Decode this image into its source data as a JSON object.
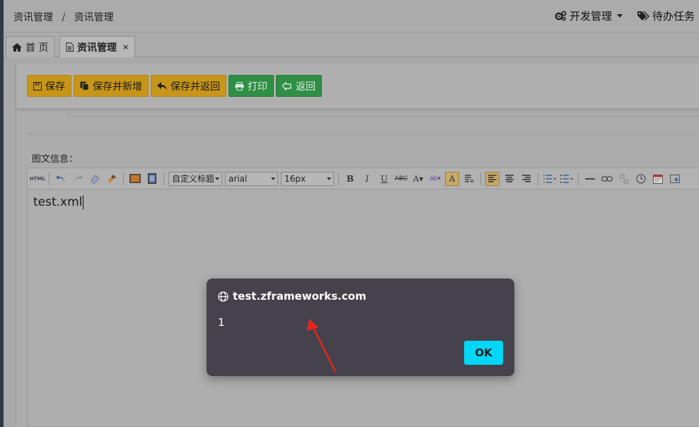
{
  "breadcrumb": {
    "part1": "资讯管理",
    "separator": "/",
    "part2": "资讯管理"
  },
  "top_menu": {
    "dev_manage": "开发管理",
    "todo": "待办任务"
  },
  "tabs": [
    {
      "label": "首 页",
      "icon": "home-icon"
    },
    {
      "label": "资讯管理",
      "icon": "document-icon",
      "close": "×"
    }
  ],
  "actions": {
    "save": "保存",
    "save_new": "保存并新增",
    "save_return": "保存并返回",
    "print": "打印",
    "back": "返回"
  },
  "section_label": "图文信息：",
  "editor": {
    "html_label": "HTML",
    "heading_select": "自定义标题",
    "font_select": "arial",
    "size_select": "16px",
    "content": "test.xml"
  },
  "dialog": {
    "title": "test.zframeworks.com",
    "message": "1",
    "ok": "OK"
  },
  "colors": {
    "warning_button": "#c79519",
    "success_button": "#2e8f45",
    "dialog_bg": "#45424c",
    "ok_button": "#00d6f5",
    "annotation_arrow": "#e8251b"
  }
}
